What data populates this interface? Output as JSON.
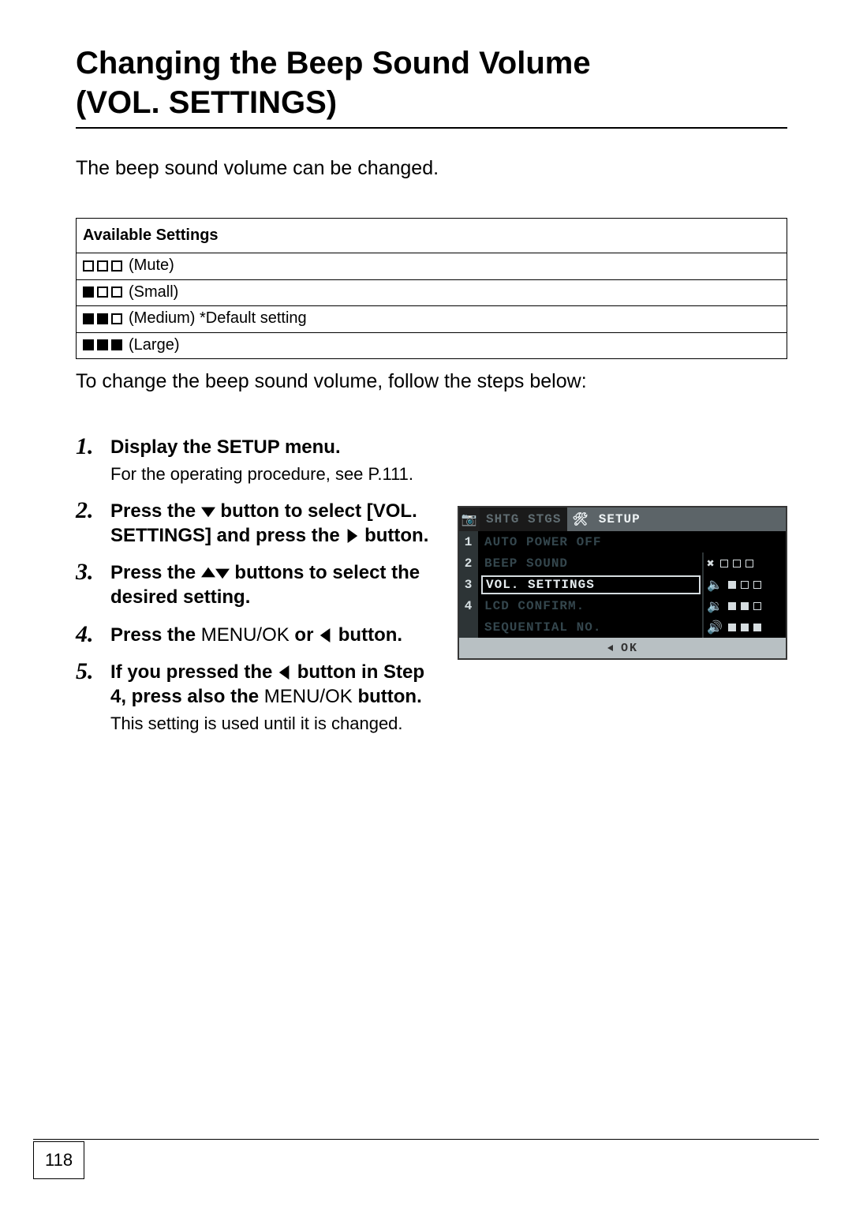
{
  "title_line1": "Changing the Beep Sound Volume",
  "title_line2": "(VOL. SETTINGS)",
  "intro": "The beep sound volume can be changed.",
  "settings_header": "Available Settings",
  "settings": [
    {
      "level": 0,
      "label": "(Mute)"
    },
    {
      "level": 1,
      "label": "(Small)"
    },
    {
      "level": 2,
      "label": "(Medium) *Default setting"
    },
    {
      "level": 3,
      "label": "(Large)"
    }
  ],
  "lead": "To change the beep sound volume, follow the steps below:",
  "steps": {
    "s1_title": "Display the SETUP menu.",
    "s1_body": "For the operating procedure, see P.111.",
    "s2_title_a": "Press the ",
    "s2_title_b": " button to select [VOL. SETTINGS] and press the ",
    "s2_title_c": " button.",
    "s3_title_a": "Press the ",
    "s3_title_b": " buttons to select the desired setting.",
    "s4_title_a": "Press the ",
    "s4_menu": "MENU/OK",
    "s4_title_b": " or ",
    "s4_title_c": " button.",
    "s5_title_a": "If you pressed the ",
    "s5_title_b": " button in Step 4, press also the ",
    "s5_menu": "MENU/OK",
    "s5_title_c": " button.",
    "s5_body": "This setting is used until it is changed."
  },
  "lcd": {
    "tab_inactive": "SHTG STGS",
    "tab_active": "SETUP",
    "rows": [
      {
        "n": "1",
        "label": "AUTO POWER OFF"
      },
      {
        "n": "2",
        "label": "BEEP SOUND"
      },
      {
        "n": "3",
        "label": "VOL. SETTINGS"
      },
      {
        "n": "4",
        "label": "LCD CONFIRM."
      },
      {
        "n": "",
        "label": "SEQUENTIAL NO."
      }
    ],
    "ok": "OK"
  },
  "page_number": "118"
}
